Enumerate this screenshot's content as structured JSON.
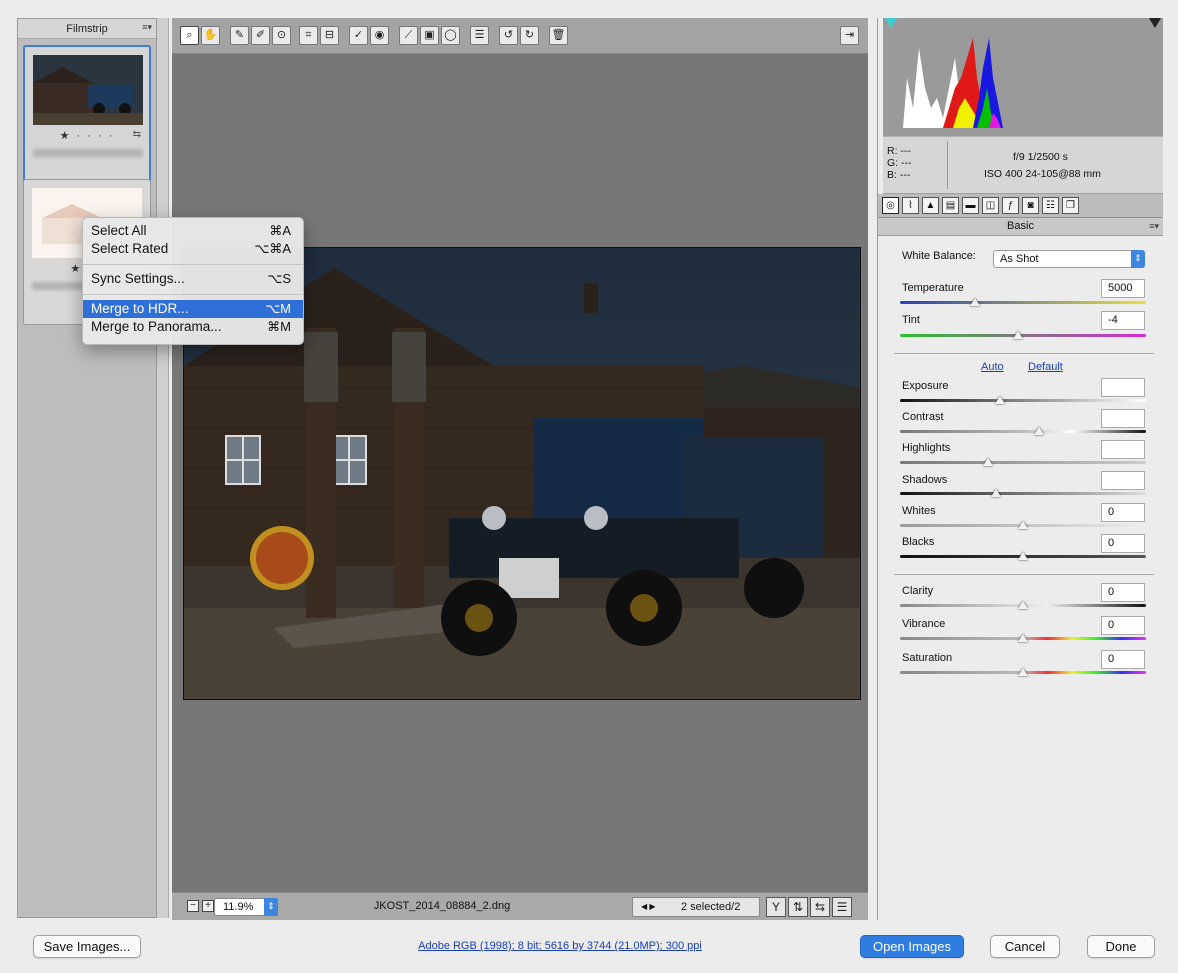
{
  "filmstrip": {
    "title": "Filmstrip",
    "menu_glyph": "≡▾",
    "items": [
      {
        "rating": "★ · · · ·",
        "selected": true
      },
      {
        "rating": "★ · ·",
        "selected": false
      }
    ]
  },
  "context_menu": {
    "items": [
      {
        "label": "Select All",
        "shortcut": "⌘A"
      },
      {
        "label": "Select Rated",
        "shortcut": "⌥⌘A"
      },
      {
        "label": "Sync Settings...",
        "shortcut": "⌥S"
      },
      {
        "label": "Merge to HDR...",
        "shortcut": "⌥M",
        "highlighted": true
      },
      {
        "label": "Merge to Panorama...",
        "shortcut": "⌘M"
      }
    ]
  },
  "toolbar": {
    "tools": [
      "zoom-icon",
      "hand-icon",
      "white-balance-icon",
      "color-sampler-icon",
      "targeted-adjustment-icon",
      "crop-icon",
      "straighten-icon",
      "spot-removal-icon",
      "red-eye-icon",
      "adjustment-brush-icon",
      "graduated-filter-icon",
      "radial-filter-icon",
      "preferences-icon",
      "rotate-left-icon",
      "rotate-right-icon",
      "trash-icon"
    ],
    "fullscreen_icon": "fullscreen-icon"
  },
  "status": {
    "zoom": "11.9%",
    "filename": "JKOST_2014_08884_2.dng",
    "selection": "2 selected/2"
  },
  "camera_info": {
    "r": "R:   ---",
    "g": "G:   ---",
    "b": "B:   ---",
    "exposure": "f/9   1/2500 s",
    "iso": "ISO 400   24-105@88 mm"
  },
  "panel": {
    "title": "Basic",
    "white_balance_label": "White Balance:",
    "white_balance_value": "As Shot",
    "temperature_label": "Temperature",
    "temperature_value": "5000",
    "tint_label": "Tint",
    "tint_value": "-4",
    "auto_label": "Auto",
    "default_label": "Default",
    "sliders": [
      {
        "label": "Exposure",
        "value": ""
      },
      {
        "label": "Contrast",
        "value": ""
      },
      {
        "label": "Highlights",
        "value": ""
      },
      {
        "label": "Shadows",
        "value": ""
      },
      {
        "label": "Whites",
        "value": "0"
      },
      {
        "label": "Blacks",
        "value": "0"
      }
    ],
    "presence": [
      {
        "label": "Clarity",
        "value": "0"
      },
      {
        "label": "Vibrance",
        "value": "0"
      },
      {
        "label": "Saturation",
        "value": "0"
      }
    ]
  },
  "bottom": {
    "save_label": "Save Images...",
    "info_link": "Adobe RGB (1998); 8 bit; 5616 by 3744 (21.0MP); 300 ppi",
    "open_label": "Open Images",
    "cancel_label": "Cancel",
    "done_label": "Done"
  },
  "colors": {
    "accent": "#2f7de1",
    "menu_highlight": "#2f6fd8",
    "link": "#1a3fb5"
  }
}
